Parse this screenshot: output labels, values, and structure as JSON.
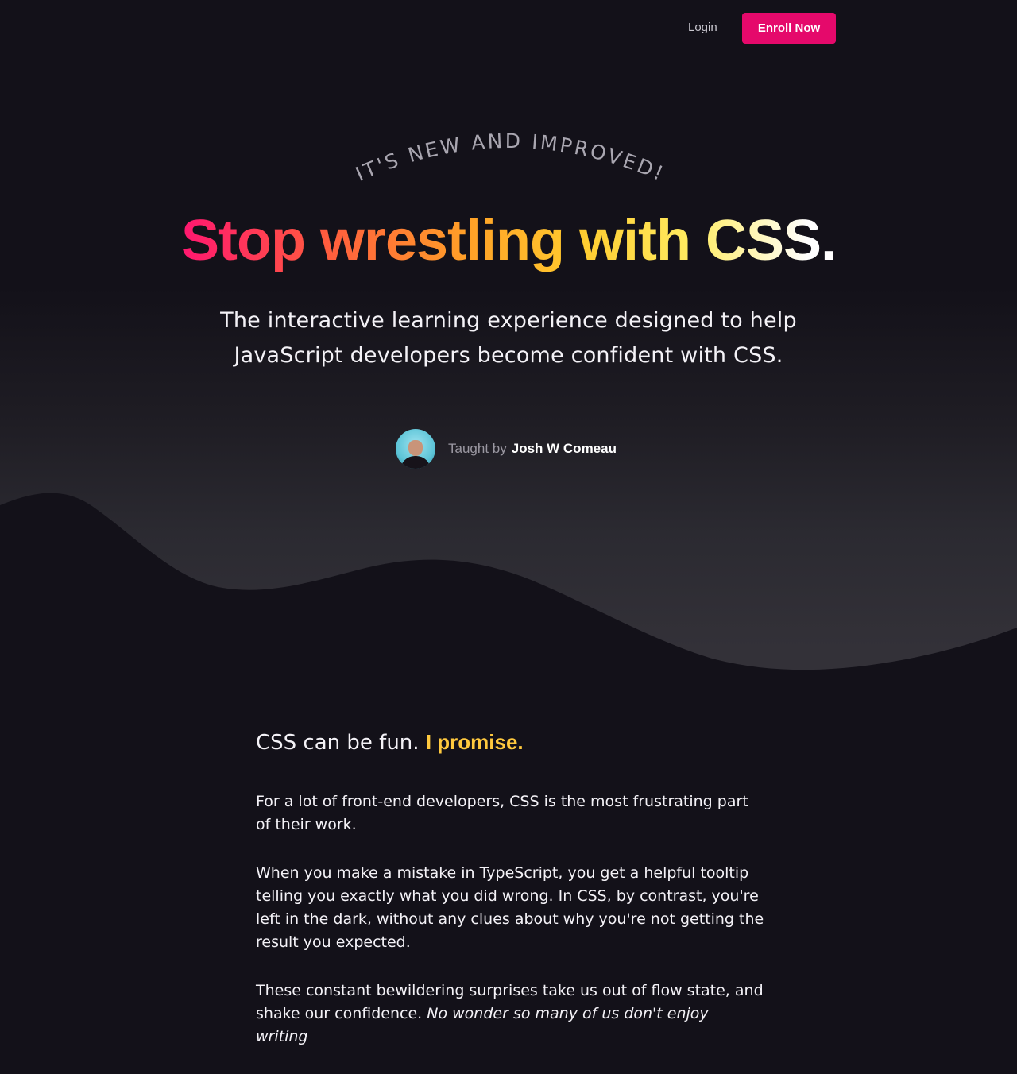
{
  "nav": {
    "login_label": "Login",
    "enroll_label": "Enroll Now",
    "accent_color": "#e5096b"
  },
  "hero": {
    "eyebrow": "IT'S NEW AND IMPROVED!",
    "headline_gradient": "Stop wrestling with CSS",
    "headline_period": ".",
    "subtitle_line1": "The interactive learning experience designed to help",
    "subtitle_line2": "JavaScript developers become confident with CSS.",
    "taught_by_label": "Taught by",
    "teacher_name": "Josh W Comeau",
    "avatar_icon": "teacher-avatar"
  },
  "intro": {
    "title_plain": "CSS can be fun.",
    "title_highlight": "I promise.",
    "highlight_color": "#ffc93e",
    "paragraphs": [
      "For a lot of front-end developers, CSS is the most frustrating part of their work.",
      "When you make a mistake in TypeScript, you get a helpful tooltip telling you exactly what you did wrong. In CSS, by contrast, you're left in the dark, without any clues about why you're not getting the result you expected."
    ],
    "paragraph3_plain": "These constant bewildering surprises take us out of flow state, and shake our confidence.",
    "paragraph3_italic": "No wonder so many of us don't enjoy writing"
  }
}
